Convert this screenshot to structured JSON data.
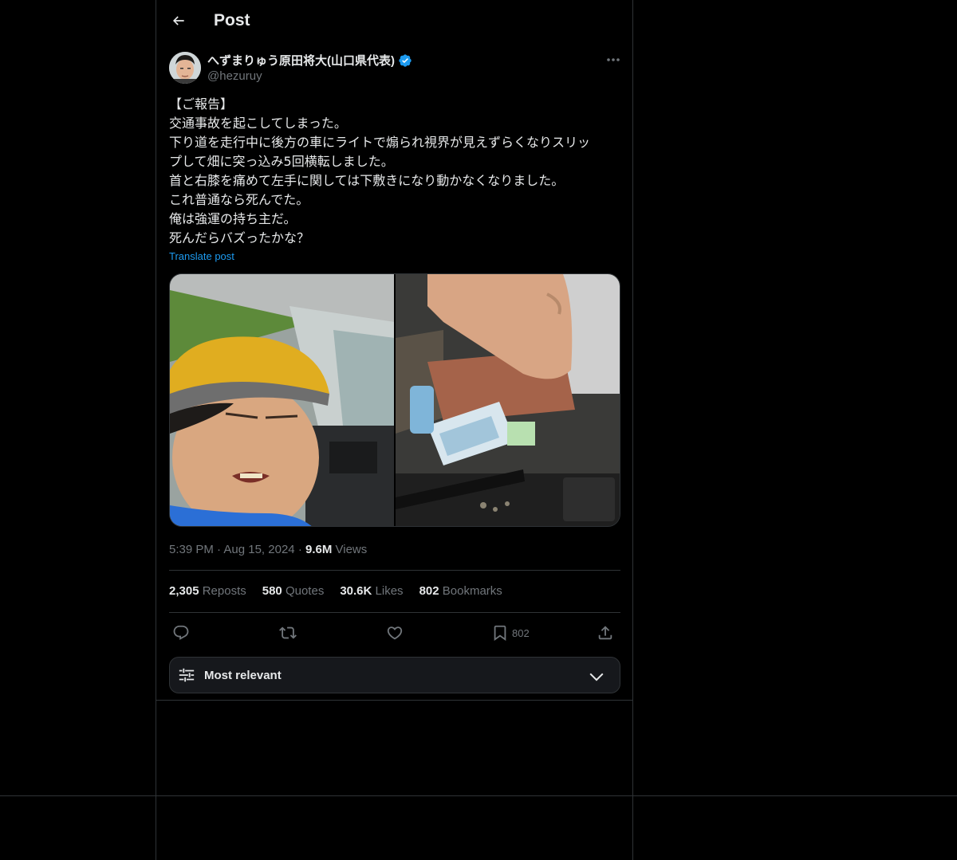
{
  "header": {
    "title": "Post"
  },
  "author": {
    "name": "へずまりゅう原田将大(山口県代表)",
    "handle": "@hezuruy",
    "verified_color": "#1d9bf0"
  },
  "post": {
    "lines": [
      "【ご報告】",
      "交通事故を起こしてしまった。",
      "下り道を走行中に後方の車にライトで煽られ視界が見えずらくなりスリッ",
      "プして畑に突っ込み5回横転しました。",
      "首と右膝を痛めて左手に関しては下敷きになり動かなくなりました。",
      "これ普通なら死んでた。",
      "俺は強運の持ち主だ。",
      "死んだらバズったかな？"
    ],
    "translate_label": "Translate post"
  },
  "meta": {
    "time": "5:39 PM",
    "date": "Aug 15, 2024",
    "views_count": "9.6M",
    "views_label": "Views"
  },
  "stats": {
    "reposts_count": "2,305",
    "reposts_label": "Reposts",
    "quotes_count": "580",
    "quotes_label": "Quotes",
    "likes_count": "30.6K",
    "likes_label": "Likes",
    "bookmarks_count": "802",
    "bookmarks_label": "Bookmarks"
  },
  "actions": {
    "reply_icon": "reply-icon",
    "repost_icon": "repost-icon",
    "like_icon": "heart-icon",
    "bookmark_icon": "bookmark-icon",
    "bookmark_count": "802",
    "share_icon": "share-icon"
  },
  "sort": {
    "label": "Most relevant"
  },
  "colors": {
    "background": "#000000",
    "border": "#2f3336",
    "text": "#e7e9ea",
    "muted": "#71767b",
    "accent": "#1d9bf0"
  }
}
